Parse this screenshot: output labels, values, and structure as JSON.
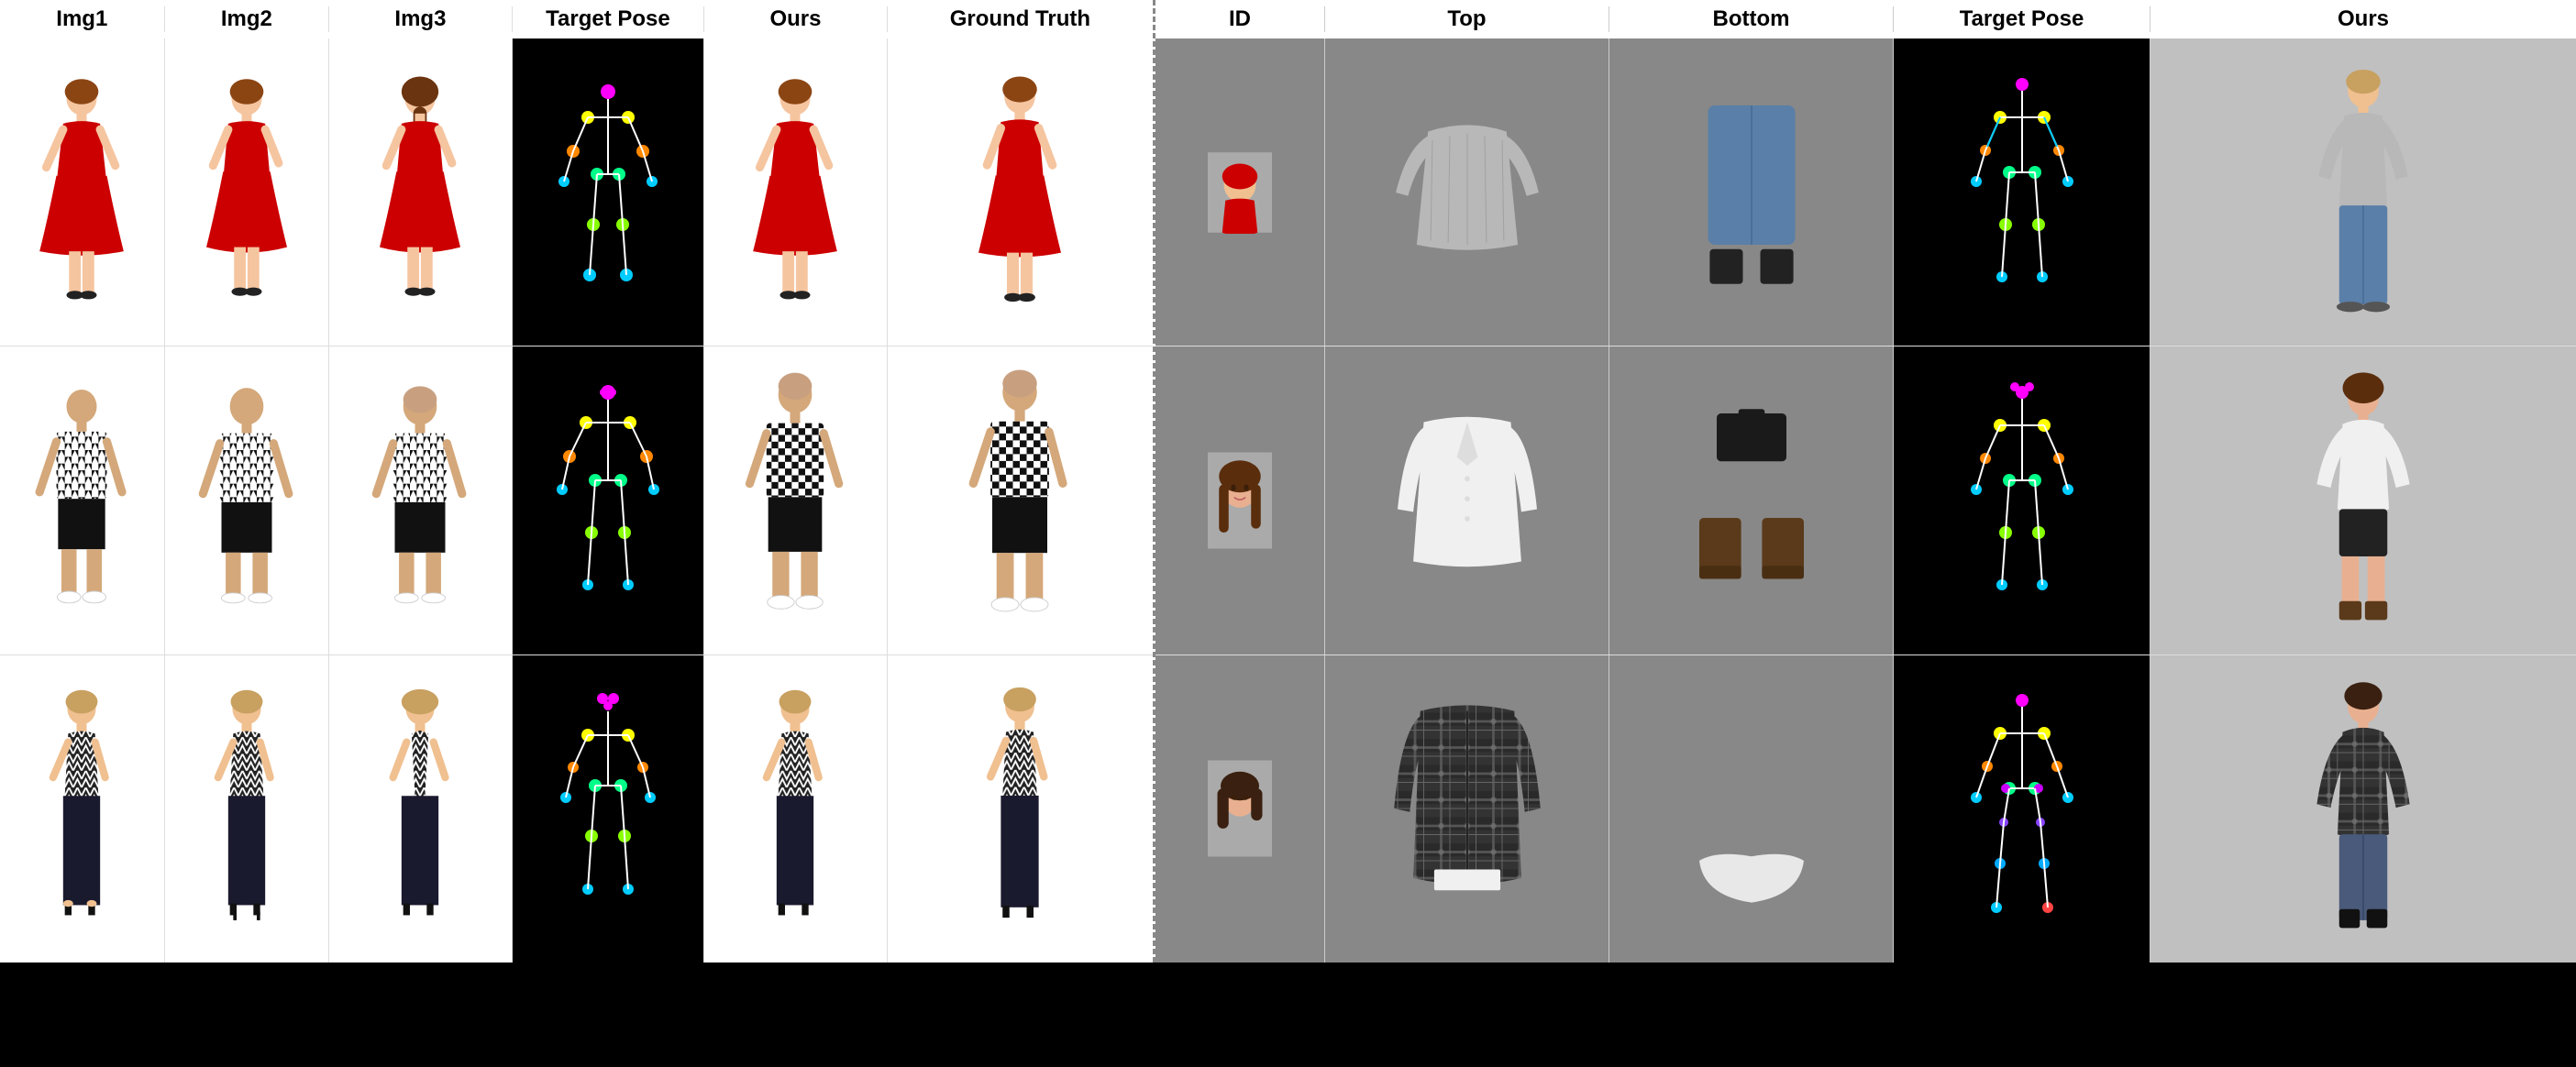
{
  "left_panel": {
    "headers": [
      "Img1",
      "Img2",
      "Img3",
      "Target Pose",
      "Ours",
      "Ground Truth"
    ],
    "rows": [
      {
        "id": "row1",
        "description": "red dress woman"
      },
      {
        "id": "row2",
        "description": "black white pattern man"
      },
      {
        "id": "row3",
        "description": "dark zigzag woman"
      }
    ]
  },
  "right_panel": {
    "headers": [
      "ID",
      "Top",
      "Bottom",
      "Target Pose",
      "Ours"
    ],
    "rows": [
      {
        "id": "row1",
        "description": "gray sweater jeans"
      },
      {
        "id": "row2",
        "description": "white jacket black bag boots"
      },
      {
        "id": "row3",
        "description": "plaid shirt"
      }
    ]
  }
}
